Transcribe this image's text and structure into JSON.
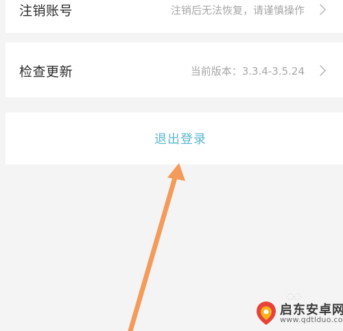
{
  "settings": {
    "cancel_account": {
      "title": "注销账号",
      "value": "注销后无法恢复，请谨慎操作"
    },
    "check_update": {
      "title": "检查更新",
      "value": "当前版本：3.3.4-3.5.24"
    },
    "logout": {
      "label": "退出登录"
    }
  },
  "annotation": {
    "arrow_color": "#f49a5a",
    "arrow_target": "logout-button"
  },
  "watermark": {
    "name": "启东安卓网",
    "url": "www.qdtlduo.com",
    "logo_colors": [
      "#e8433a",
      "#f6b21b"
    ]
  },
  "colors": {
    "page_background": "#f4f4f4",
    "row_background": "#ffffff",
    "primary_text": "#2b2b2b",
    "secondary_text": "#a6a6a6",
    "logout_accent": "#5ab7cf"
  },
  "icons": [
    "chevron-right-icon",
    "annotation-arrow",
    "watermark-logo-icon"
  ]
}
